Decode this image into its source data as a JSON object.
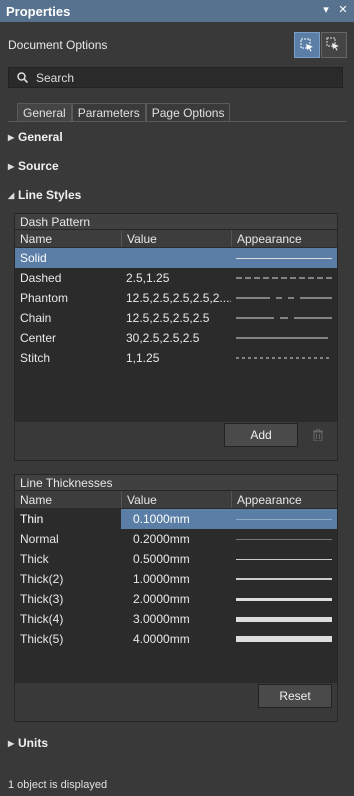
{
  "window": {
    "title": "Properties",
    "pin_glyph": "▾",
    "close_glyph": "✕"
  },
  "document_options_label": "Document Options",
  "search": {
    "placeholder": "Search"
  },
  "tabs": [
    {
      "label": "General",
      "active": true
    },
    {
      "label": "Parameters",
      "active": false
    },
    {
      "label": "Page Options",
      "active": false
    }
  ],
  "sections": {
    "general": "General",
    "source": "Source",
    "line_styles": "Line Styles",
    "units": "Units"
  },
  "dash_pattern": {
    "title": "Dash Pattern",
    "columns": [
      "Name",
      "Value",
      "Appearance"
    ],
    "rows": [
      {
        "name": "Solid",
        "value": "",
        "style": "solid",
        "selected": true
      },
      {
        "name": "Dashed",
        "value": "2.5,1.25",
        "style": "dashed",
        "selected": false
      },
      {
        "name": "Phantom",
        "value": "12.5,2.5,2.5,2.5,2....",
        "style": "phantom",
        "selected": false
      },
      {
        "name": "Chain",
        "value": "12.5,2.5,2.5,2.5",
        "style": "chain",
        "selected": false
      },
      {
        "name": "Center",
        "value": "30,2.5,2.5,2.5",
        "style": "center",
        "selected": false
      },
      {
        "name": "Stitch",
        "value": "1,1.25",
        "style": "stitch",
        "selected": false
      }
    ],
    "add_label": "Add"
  },
  "line_thicknesses": {
    "title": "Line Thicknesses",
    "columns": [
      "Name",
      "Value",
      "Appearance"
    ],
    "rows": [
      {
        "name": "Thin",
        "value": "0.1000mm",
        "selected": true
      },
      {
        "name": "Normal",
        "value": "0.2000mm",
        "selected": false
      },
      {
        "name": "Thick",
        "value": "0.5000mm",
        "selected": false
      },
      {
        "name": "Thick(2)",
        "value": "1.0000mm",
        "selected": false
      },
      {
        "name": "Thick(3)",
        "value": "2.0000mm",
        "selected": false
      },
      {
        "name": "Thick(4)",
        "value": "3.0000mm",
        "selected": false
      },
      {
        "name": "Thick(5)",
        "value": "4.0000mm",
        "selected": false
      }
    ],
    "reset_label": "Reset"
  },
  "status": "1 object is displayed",
  "colors": {
    "accent": "#5a7ea6",
    "titlebar": "#56728e",
    "panel": "#393939"
  }
}
